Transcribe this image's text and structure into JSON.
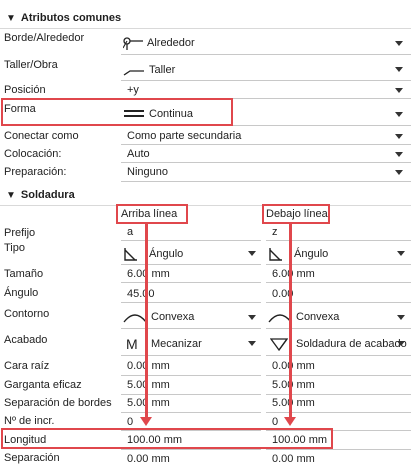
{
  "sections": {
    "common": "Atributos comunes",
    "weld": "Soldadura"
  },
  "common": {
    "border": {
      "label": "Borde/Alrededor",
      "value": "Alrededor"
    },
    "workshop": {
      "label": "Taller/Obra",
      "value": "Taller"
    },
    "position": {
      "label": "Posición",
      "value": "+y"
    },
    "shape": {
      "label": "Forma",
      "value": "Continua"
    },
    "connect": {
      "label": "Conectar como",
      "value": "Como parte secundaria"
    },
    "placement": {
      "label": "Colocación:",
      "value": "Auto"
    },
    "preparation": {
      "label": "Preparación:",
      "value": "Ninguno"
    }
  },
  "weld": {
    "col_above": "Arriba línea",
    "col_below": "Debajo línea",
    "rows": {
      "prefix": {
        "label": "Prefijo",
        "above": "a",
        "below": "z"
      },
      "type": {
        "label": "Tipo",
        "above": "Ángulo",
        "below": "Ángulo"
      },
      "size": {
        "label": "Tamaño",
        "above": "6.00 mm",
        "below": "6.00 mm"
      },
      "angle": {
        "label": "Ángulo",
        "above": "45.00",
        "below": "0.00"
      },
      "contour": {
        "label": "Contorno",
        "above": "Convexa",
        "below": "Convexa"
      },
      "finish": {
        "label": "Acabado",
        "above_glyph": "M",
        "above": "Mecanizar",
        "below": "Soldadura de acabado"
      },
      "root_face": {
        "label": "Cara raíz",
        "above": "0.00 mm",
        "below": "0.00 mm"
      },
      "throat": {
        "label": "Garganta eficaz",
        "above": "5.00 mm",
        "below": "5.00 mm"
      },
      "edge_sep": {
        "label": "Separación de bordes",
        "above": "5.00 mm",
        "below": "5.00 mm"
      },
      "increments": {
        "label": "Nº de incr.",
        "above": "0",
        "below": "0"
      },
      "length": {
        "label": "Longitud",
        "above": "100.00 mm",
        "below": "100.00 mm"
      },
      "separation": {
        "label": "Separación",
        "above": "0.00 mm",
        "below": "0.00 mm"
      }
    }
  },
  "icons": {
    "section_toggle": "triangle-down-icon",
    "border": "around-weld-icon",
    "workshop": "workshop-weld-icon",
    "shape": "continuous-line-icon",
    "fillet": "fillet-weld-icon",
    "convex": "convex-contour-icon",
    "finish_below": "finish-weld-icon",
    "dropdown": "chevron-down-icon"
  },
  "colors": {
    "highlight": "#e0474c",
    "separator": "#d9d9d9"
  }
}
